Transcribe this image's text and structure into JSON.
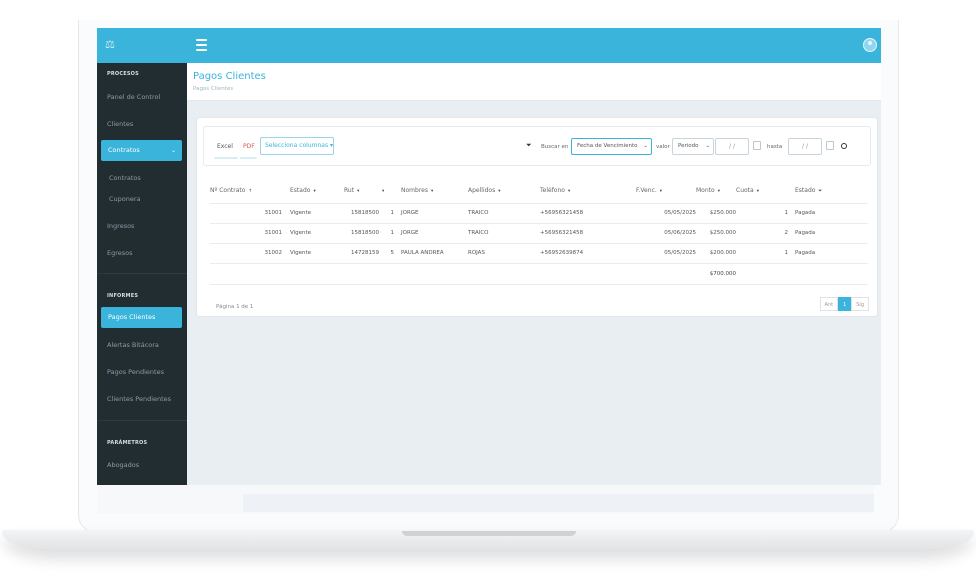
{
  "sidebar": {
    "sections": [
      "PROCESOS",
      "INFORMES",
      "PARÁMETROS"
    ],
    "items": [
      {
        "label": "Panel de Control"
      },
      {
        "label": "Clientes"
      },
      {
        "label": "Contratos",
        "active": true
      },
      {
        "label": "Contratos",
        "sub": true
      },
      {
        "label": "Cuponera",
        "sub": true
      },
      {
        "label": "Ingresos"
      },
      {
        "label": "Egresos"
      },
      {
        "label": "Pagos Clientes",
        "active": true
      },
      {
        "label": "Alertas Bitácora"
      },
      {
        "label": "Pagos Pendientes"
      },
      {
        "label": "Clientes Pendientes"
      },
      {
        "label": "Abogados"
      }
    ]
  },
  "header": {
    "title": "Pagos Clientes",
    "breadcrumb": "Pagos Clientes"
  },
  "toolbar": {
    "excel": "Excel",
    "pdf": "PDF",
    "select_columns": "Selecciona columnas",
    "search_in_label": "Buscar en",
    "search_in_value": "Fecha de Vencimiento",
    "value_label": "valor",
    "period_value": "Periodo",
    "date_from": "/ /",
    "to_label": "hasta",
    "date_to": "/ /"
  },
  "table": {
    "columns": [
      "Nº Contrato",
      "Estado",
      "Rut",
      "",
      "Nombres",
      "Apellidos",
      "Teléfono",
      "F.Venc.",
      "Monto",
      "Cuota",
      "Estado"
    ],
    "rows": [
      [
        "31001",
        "Vigente",
        "15818500",
        "1",
        "JORGE",
        "TRAICO",
        "+56956321458",
        "05/05/2025",
        "$250.000",
        "1",
        "Pagada"
      ],
      [
        "31001",
        "Vigente",
        "15818500",
        "1",
        "JORGE",
        "TRAICO",
        "+56956321458",
        "05/06/2025",
        "$250.000",
        "2",
        "Pagada"
      ],
      [
        "31002",
        "Vigente",
        "14728159",
        "5",
        "PAULA ANDREA",
        "ROJAS",
        "+56952639874",
        "05/05/2025",
        "$200.000",
        "1",
        "Pagada"
      ]
    ],
    "total": "$700.000"
  },
  "pagination": {
    "info": "Página 1 de 1",
    "prev": "Ant",
    "current": "1",
    "next": "Sig"
  },
  "colors": {
    "accent": "#3bb4dc",
    "sidebar": "#222d32",
    "background": "#e9eef2",
    "pdf": "#e0564a"
  }
}
